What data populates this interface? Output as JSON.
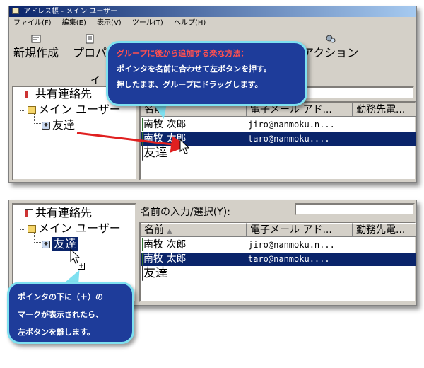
{
  "window": {
    "title": "アドレス帳 - メイン ユーザー"
  },
  "menu": [
    "ファイル(F)",
    "編集(E)",
    "表示(V)",
    "ツール(T)",
    "ヘルプ(H)"
  ],
  "toolbar": {
    "new_label": "新規作成",
    "prop_label": "プロパ",
    "prop_sub": "イ",
    "action_label": "アクション"
  },
  "tree": {
    "shared": "共有連絡先",
    "main_user": "メイン ユーザー",
    "friends": "友達"
  },
  "search": {
    "label": "名前の入力/選択(Y):",
    "value": ""
  },
  "columns": [
    "名前",
    "電子メール アド...",
    "勤務先電..."
  ],
  "contacts": [
    {
      "name": "南牧 次郎",
      "email": "jiro@nanmoku.n..."
    },
    {
      "name": "南牧 太郎",
      "email": "taro@nanmoku...."
    },
    {
      "name": "友達",
      "email": ""
    }
  ],
  "callout1": {
    "line1": "グループに後から追加する楽な方法：",
    "line2": "ポインタを名前に合わせて左ボタンを押す。",
    "line3": "押したまま、グループにドラッグします。"
  },
  "callout2": {
    "line1": "ポインタの下に（＋）の",
    "line2": "マークが表示されたら、",
    "line3": "左ボタンを離します。"
  },
  "colors": {
    "selection": "#0a246a",
    "callout_bg": "#1e3c9a",
    "callout_border": "#7ee0f0",
    "arrow": "#e02020",
    "callout_highlight": "#ff5050"
  }
}
